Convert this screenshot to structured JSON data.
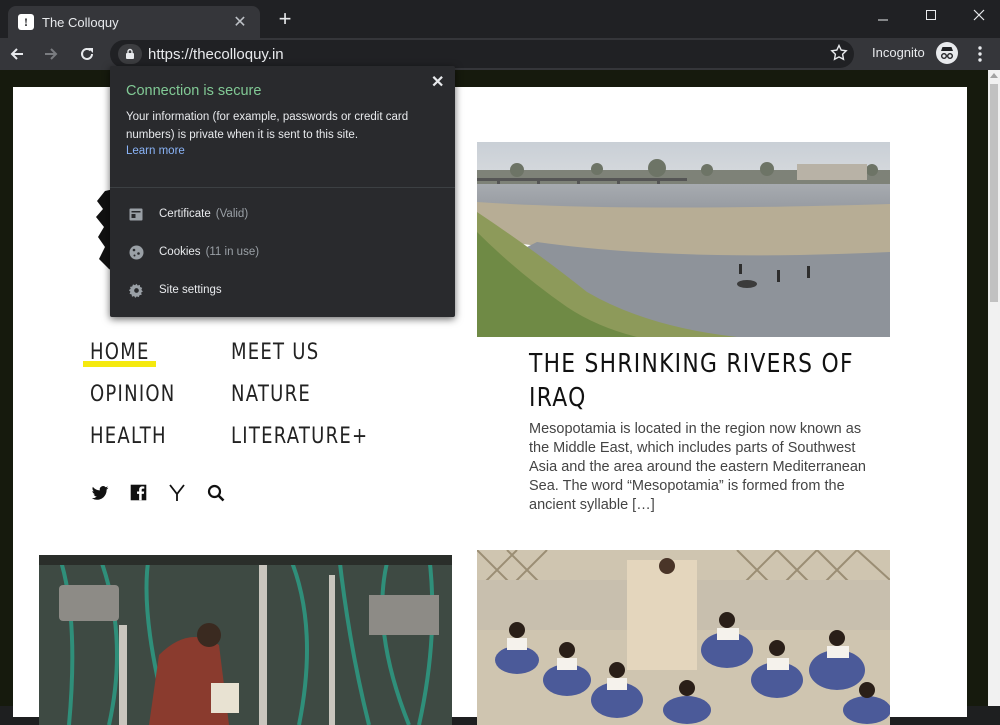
{
  "browser": {
    "tab_title": "The Colloquy",
    "tab_close": "✕",
    "new_tab": "+",
    "url": "https://thecolloquy.in",
    "incognito_label": "Incognito"
  },
  "site_info_popup": {
    "heading": "Connection is secure",
    "close": "✕",
    "description": "Your information (for example, passwords or credit card numbers) is private when it is sent to this site.",
    "learn_more": "Learn more",
    "rows": [
      {
        "label": "Certificate",
        "sub": "(Valid)",
        "icon": "certificate-icon"
      },
      {
        "label": "Cookies",
        "sub": "(11 in use)",
        "icon": "cookie-icon"
      },
      {
        "label": "Site settings",
        "sub": "",
        "icon": "gear-icon"
      }
    ]
  },
  "site": {
    "menu": {
      "home": "HOME",
      "meet_us": "MEET US",
      "opinion": "OPINION",
      "nature": "NATURE",
      "health": "HEALTH",
      "literature": "LITERATURE+"
    },
    "social_icons": [
      "twitter-icon",
      "facebook-icon",
      "ycombinator-icon",
      "search-icon"
    ],
    "highlight_color": "#f5e90e",
    "article": {
      "title": "THE SHRINKING RIVERS OF IRAQ",
      "excerpt": "Mesopotamia is located in the region now known as the Middle East, which includes parts of Southwest Asia and the area around the eastern Mediterranean Sea. The word “Mesopotamia” is formed from the ancient syllable […]"
    }
  },
  "colors": {
    "secure_green": "#81c995",
    "link_blue": "#8ab4f8",
    "page_background": "#161a0d"
  }
}
